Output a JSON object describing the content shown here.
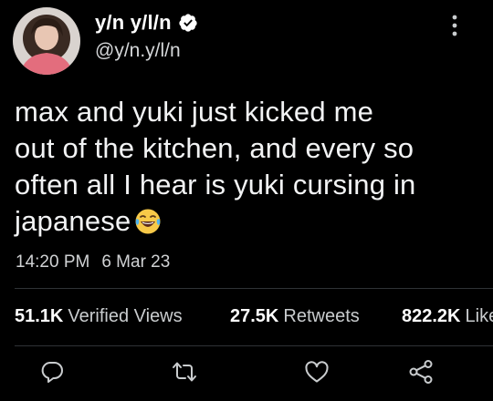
{
  "tweet": {
    "display_name": "y/n y/l/n",
    "handle": "@y/n.y/l/n",
    "text_lines": [
      "max and yuki just kicked me",
      "out of the kitchen, and every so",
      "often all I hear is yuki cursing in",
      "japanese"
    ],
    "emoji": "laughing-with-tears",
    "time": "14:20 PM",
    "date": "6 Mar 23"
  },
  "stats": {
    "views_count": "51.1K",
    "views_label": "Verified Views",
    "retweets_count": "27.5K",
    "retweets_label": "Retweets",
    "likes_count": "822.2K",
    "likes_label": "Likes"
  },
  "icons": {
    "verified": "verified-badge-icon",
    "more": "more-vertical-icon",
    "reply": "reply-icon",
    "retweet": "retweet-icon",
    "like": "heart-icon",
    "share": "share-icon"
  },
  "colors": {
    "background": "#000000",
    "text": "#e7e9ea",
    "divider": "#2f3336",
    "verified": "#ffffff"
  }
}
